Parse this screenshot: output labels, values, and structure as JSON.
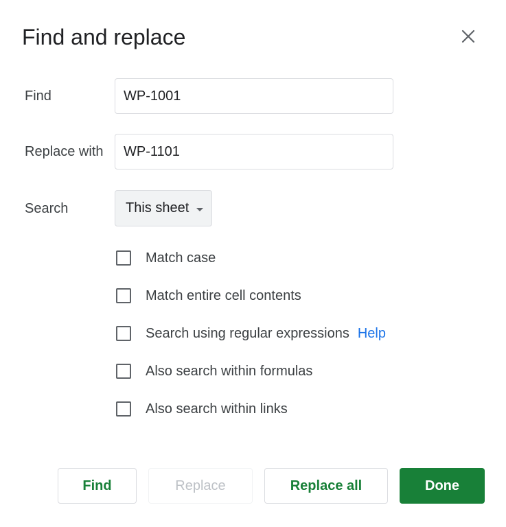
{
  "dialog": {
    "title": "Find and replace",
    "close_icon": "close-icon"
  },
  "find": {
    "label": "Find",
    "value": "WP-1001"
  },
  "replace": {
    "label": "Replace with",
    "value": "WP-1101"
  },
  "search": {
    "label": "Search",
    "selected": "This sheet",
    "icon": "dropdown-arrow-icon"
  },
  "options": {
    "match_case": "Match case",
    "match_entire": "Match entire cell contents",
    "regex": "Search using regular expressions",
    "regex_help": "Help",
    "formulas": "Also search within formulas",
    "links": "Also search within links"
  },
  "buttons": {
    "find": "Find",
    "replace": "Replace",
    "replace_all": "Replace all",
    "done": "Done"
  },
  "colors": {
    "accent_green": "#188038",
    "link_blue": "#1a73e8"
  }
}
